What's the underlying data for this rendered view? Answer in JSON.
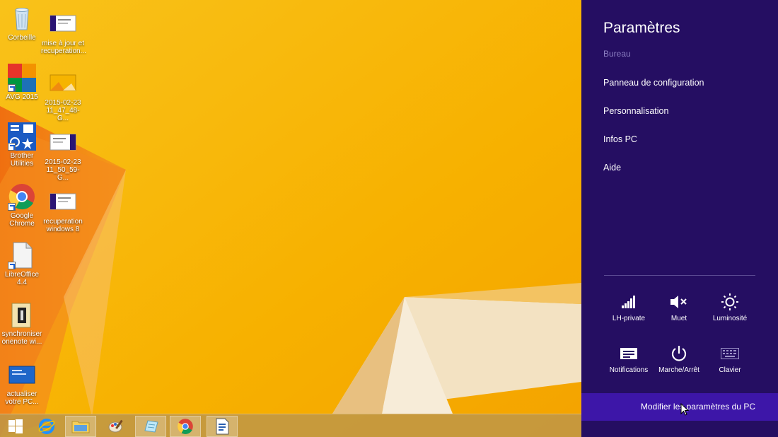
{
  "desktop": {
    "icons": [
      {
        "label": "Corbeille"
      },
      {
        "label": "mise à jour et recuperation..."
      },
      {
        "label": "AVG 2015"
      },
      {
        "label": "2015-02-23 11_47_48-G..."
      },
      {
        "label": "Brother Utilities"
      },
      {
        "label": "2015-02-23 11_50_59-G..."
      },
      {
        "label": "Google Chrome"
      },
      {
        "label": "recuperation windows 8"
      },
      {
        "label": "LibreOffice 4.4"
      },
      {
        "label": "synchroniser onenote wi..."
      },
      {
        "label": "actualiser votre PC..."
      }
    ]
  },
  "taskbar": {
    "items": [
      "start-button",
      "internet-explorer",
      "file-explorer",
      "paint",
      "notepad",
      "google-chrome",
      "wordpad"
    ]
  },
  "charms": {
    "title": "Paramètres",
    "subtitle": "Bureau",
    "links": [
      "Panneau de configuration",
      "Personnalisation",
      "Infos PC",
      "Aide"
    ],
    "quick_settings": [
      {
        "label": "LH-private",
        "icon": "wifi-signal-icon"
      },
      {
        "label": "Muet",
        "icon": "speaker-muted-icon"
      },
      {
        "label": "Luminosité",
        "icon": "brightness-icon"
      },
      {
        "label": "Notifications",
        "icon": "notifications-icon"
      },
      {
        "label": "Marche/Arrêt",
        "icon": "power-icon"
      },
      {
        "label": "Clavier",
        "icon": "keyboard-icon"
      }
    ],
    "change_pc_settings": "Modifier les paramètres du PC",
    "colors": {
      "panel": "#250e62",
      "highlight": "#3d16a8",
      "subtitle": "#8c7fc2"
    }
  }
}
